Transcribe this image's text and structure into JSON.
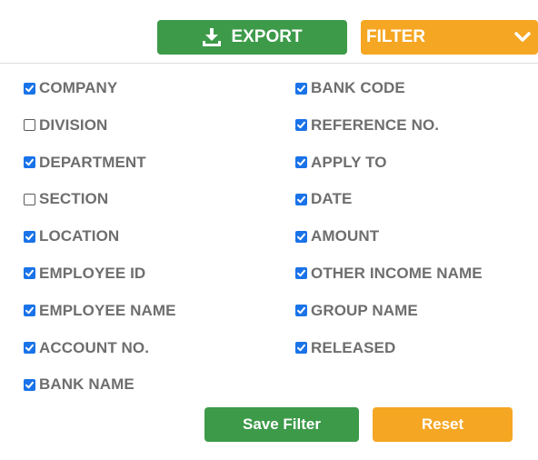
{
  "toolbar": {
    "export_label": "EXPORT",
    "filter_label": "FILTER"
  },
  "colors": {
    "green": "#3d9a49",
    "orange": "#f5a623",
    "checkbox_blue": "#1a73e8",
    "label_gray": "#6e6e6e"
  },
  "icons": {
    "export": "download-icon",
    "filter": "chevron-down-icon",
    "checked": "checkmark-icon"
  },
  "filters": {
    "left": [
      {
        "label": "COMPANY",
        "checked": true
      },
      {
        "label": "DIVISION",
        "checked": false
      },
      {
        "label": "DEPARTMENT",
        "checked": true
      },
      {
        "label": "SECTION",
        "checked": false
      },
      {
        "label": "LOCATION",
        "checked": true
      },
      {
        "label": "EMPLOYEE ID",
        "checked": true
      },
      {
        "label": "EMPLOYEE NAME",
        "checked": true
      },
      {
        "label": "ACCOUNT NO.",
        "checked": true
      },
      {
        "label": "BANK NAME",
        "checked": true
      }
    ],
    "right": [
      {
        "label": "BANK CODE",
        "checked": true
      },
      {
        "label": "REFERENCE NO.",
        "checked": true
      },
      {
        "label": "APPLY TO",
        "checked": true
      },
      {
        "label": "DATE",
        "checked": true
      },
      {
        "label": "AMOUNT",
        "checked": true
      },
      {
        "label": "OTHER INCOME NAME",
        "checked": true
      },
      {
        "label": "GROUP NAME",
        "checked": true
      },
      {
        "label": "RELEASED",
        "checked": true
      }
    ]
  },
  "actions": {
    "save_label": "Save Filter",
    "reset_label": "Reset"
  }
}
